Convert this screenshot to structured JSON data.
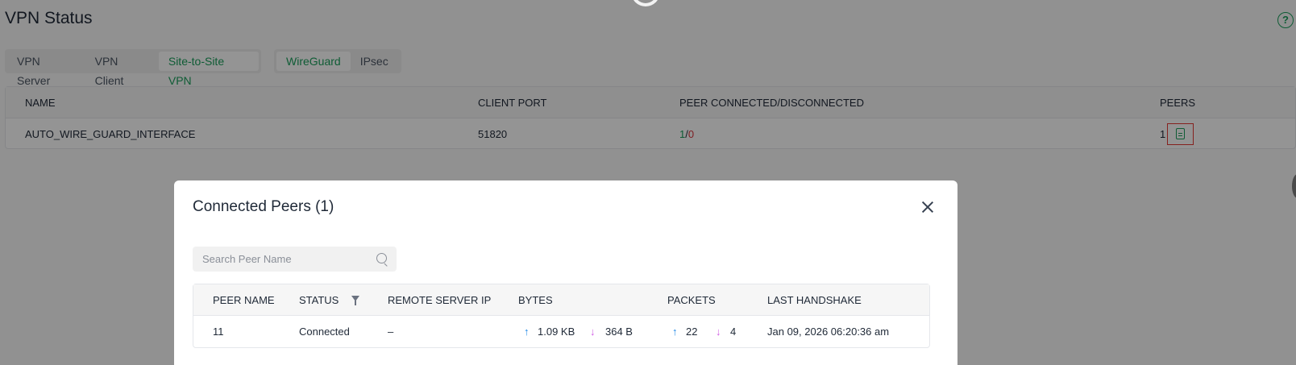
{
  "page": {
    "title": "VPN Status",
    "help_icon": "help-circle-icon",
    "help_glyph": "?"
  },
  "tabs_left": [
    {
      "label": "VPN Server",
      "active": false
    },
    {
      "label": "VPN Client",
      "active": false
    },
    {
      "label": "Site-to-Site VPN",
      "active": true
    }
  ],
  "tabs_right": [
    {
      "label": "WireGuard",
      "active": true
    },
    {
      "label": "IPsec",
      "active": false
    }
  ],
  "vpn_table": {
    "headers": {
      "name": "NAME",
      "client_port": "CLIENT PORT",
      "peer_status": "PEER CONNECTED/DISCONNECTED",
      "peers": "PEERS"
    },
    "rows": [
      {
        "name": "AUTO_WIRE_GUARD_INTERFACE",
        "client_port": "51820",
        "connected": "1",
        "separator": "/",
        "disconnected": "0",
        "peers": "1",
        "peers_icon": "document-icon"
      }
    ]
  },
  "modal": {
    "title": "Connected Peers (1)",
    "close_icon": "close-icon",
    "search_placeholder": "Search Peer Name",
    "search_value": "",
    "headers": {
      "peer_name": "PEER NAME",
      "status": "STATUS",
      "remote_ip": "REMOTE SERVER IP",
      "bytes": "BYTES",
      "packets": "PACKETS",
      "last_handshake": "LAST HANDSHAKE"
    },
    "rows": [
      {
        "peer_name": "11",
        "status": "Connected",
        "remote_ip": "–",
        "bytes_up": "1.09 KB",
        "bytes_down": "364 B",
        "packets_up": "22",
        "packets_down": "4",
        "last_handshake": "Jan 09, 2026 06:20:36 am"
      }
    ],
    "arrow_up_glyph": "↑",
    "arrow_down_glyph": "↓"
  },
  "colors": {
    "accent": "#1a9f5c",
    "error": "#d9363e",
    "upload": "#1e88e5",
    "download": "#d05ce3",
    "highlight_box": "#e53935"
  }
}
